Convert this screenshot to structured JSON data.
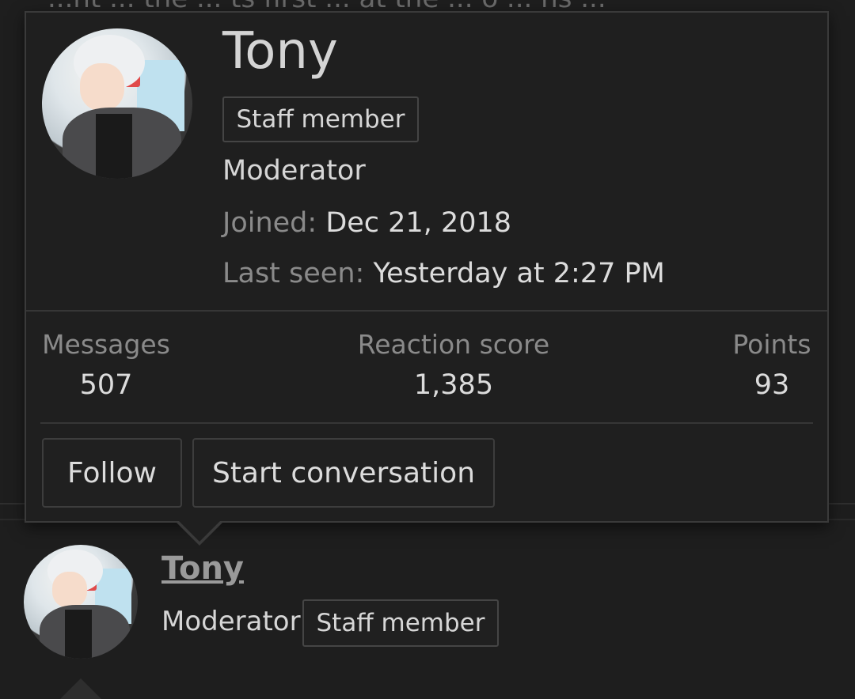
{
  "background": {
    "partial_text": "...nt ... the ... ts first ... at the ... o ... ns ..."
  },
  "member_card": {
    "username": "Tony",
    "badge": "Staff member",
    "role": "Moderator",
    "joined_label": "Joined:",
    "joined_value": "Dec 21, 2018",
    "last_seen_label": "Last seen:",
    "last_seen_value": "Yesterday at 2:27 PM",
    "stats": [
      {
        "label": "Messages",
        "value": "507"
      },
      {
        "label": "Reaction score",
        "value": "1,385"
      },
      {
        "label": "Points",
        "value": "93"
      }
    ],
    "buttons": {
      "follow": "Follow",
      "start_conversation": "Start conversation"
    }
  },
  "post_author": {
    "username": "Tony",
    "role": "Moderator",
    "badge": "Staff member"
  },
  "colors": {
    "background": "#1e1e1e",
    "card": "#1f1f1f",
    "border": "#3a3a3a",
    "muted": "#8a8a8a"
  }
}
